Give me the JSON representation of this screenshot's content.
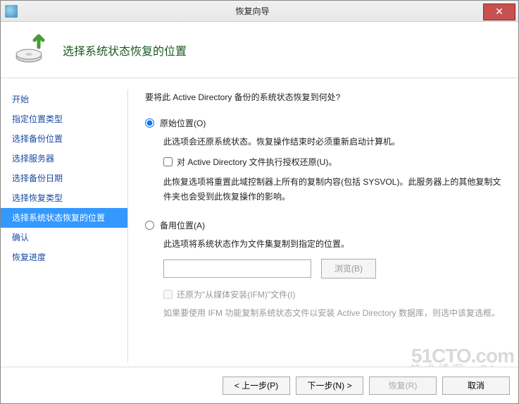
{
  "window": {
    "title": "恢复向导",
    "close": "✕"
  },
  "header": {
    "title": "选择系统状态恢复的位置"
  },
  "sidebar": {
    "items": [
      {
        "label": "开始"
      },
      {
        "label": "指定位置类型"
      },
      {
        "label": "选择备份位置"
      },
      {
        "label": "选择服务器"
      },
      {
        "label": "选择备份日期"
      },
      {
        "label": "选择恢复类型"
      },
      {
        "label": "选择系统状态恢复的位置"
      },
      {
        "label": "确认"
      },
      {
        "label": "恢复进度"
      }
    ],
    "selected_index": 6
  },
  "content": {
    "question": "要将此 Active Directory 备份的系统状态恢复到何处?",
    "option1": {
      "label": "原始位置(O)",
      "desc": "此选项会还原系统状态。恢复操作结束时必须重新启动计算机。",
      "checkbox_label": "对 Active Directory 文件执行授权还原(U)。",
      "warn": "此恢复选项将重置此域控制器上所有的复制内容(包括 SYSVOL)。此服务器上的其他复制文件夹也会受到此恢复操作的影响。"
    },
    "option2": {
      "label": "备用位置(A)",
      "desc": "此选项将系统状态作为文件集复制到指定的位置。",
      "path_value": "",
      "browse_label": "浏览(B)",
      "ifm_label": "还原为\"从媒体安装(IFM)\"文件(I)",
      "ifm_desc": "如果要使用 IFM 功能复制系统状态文件以安装 Active Directory 数据库，则选中该复选框。"
    }
  },
  "footer": {
    "prev": "< 上一步(P)",
    "next": "下一步(N) >",
    "recover": "恢复(R)",
    "cancel": "取消"
  },
  "watermark": {
    "main": "51CTO.com",
    "sub": "技术博客—Blog"
  }
}
